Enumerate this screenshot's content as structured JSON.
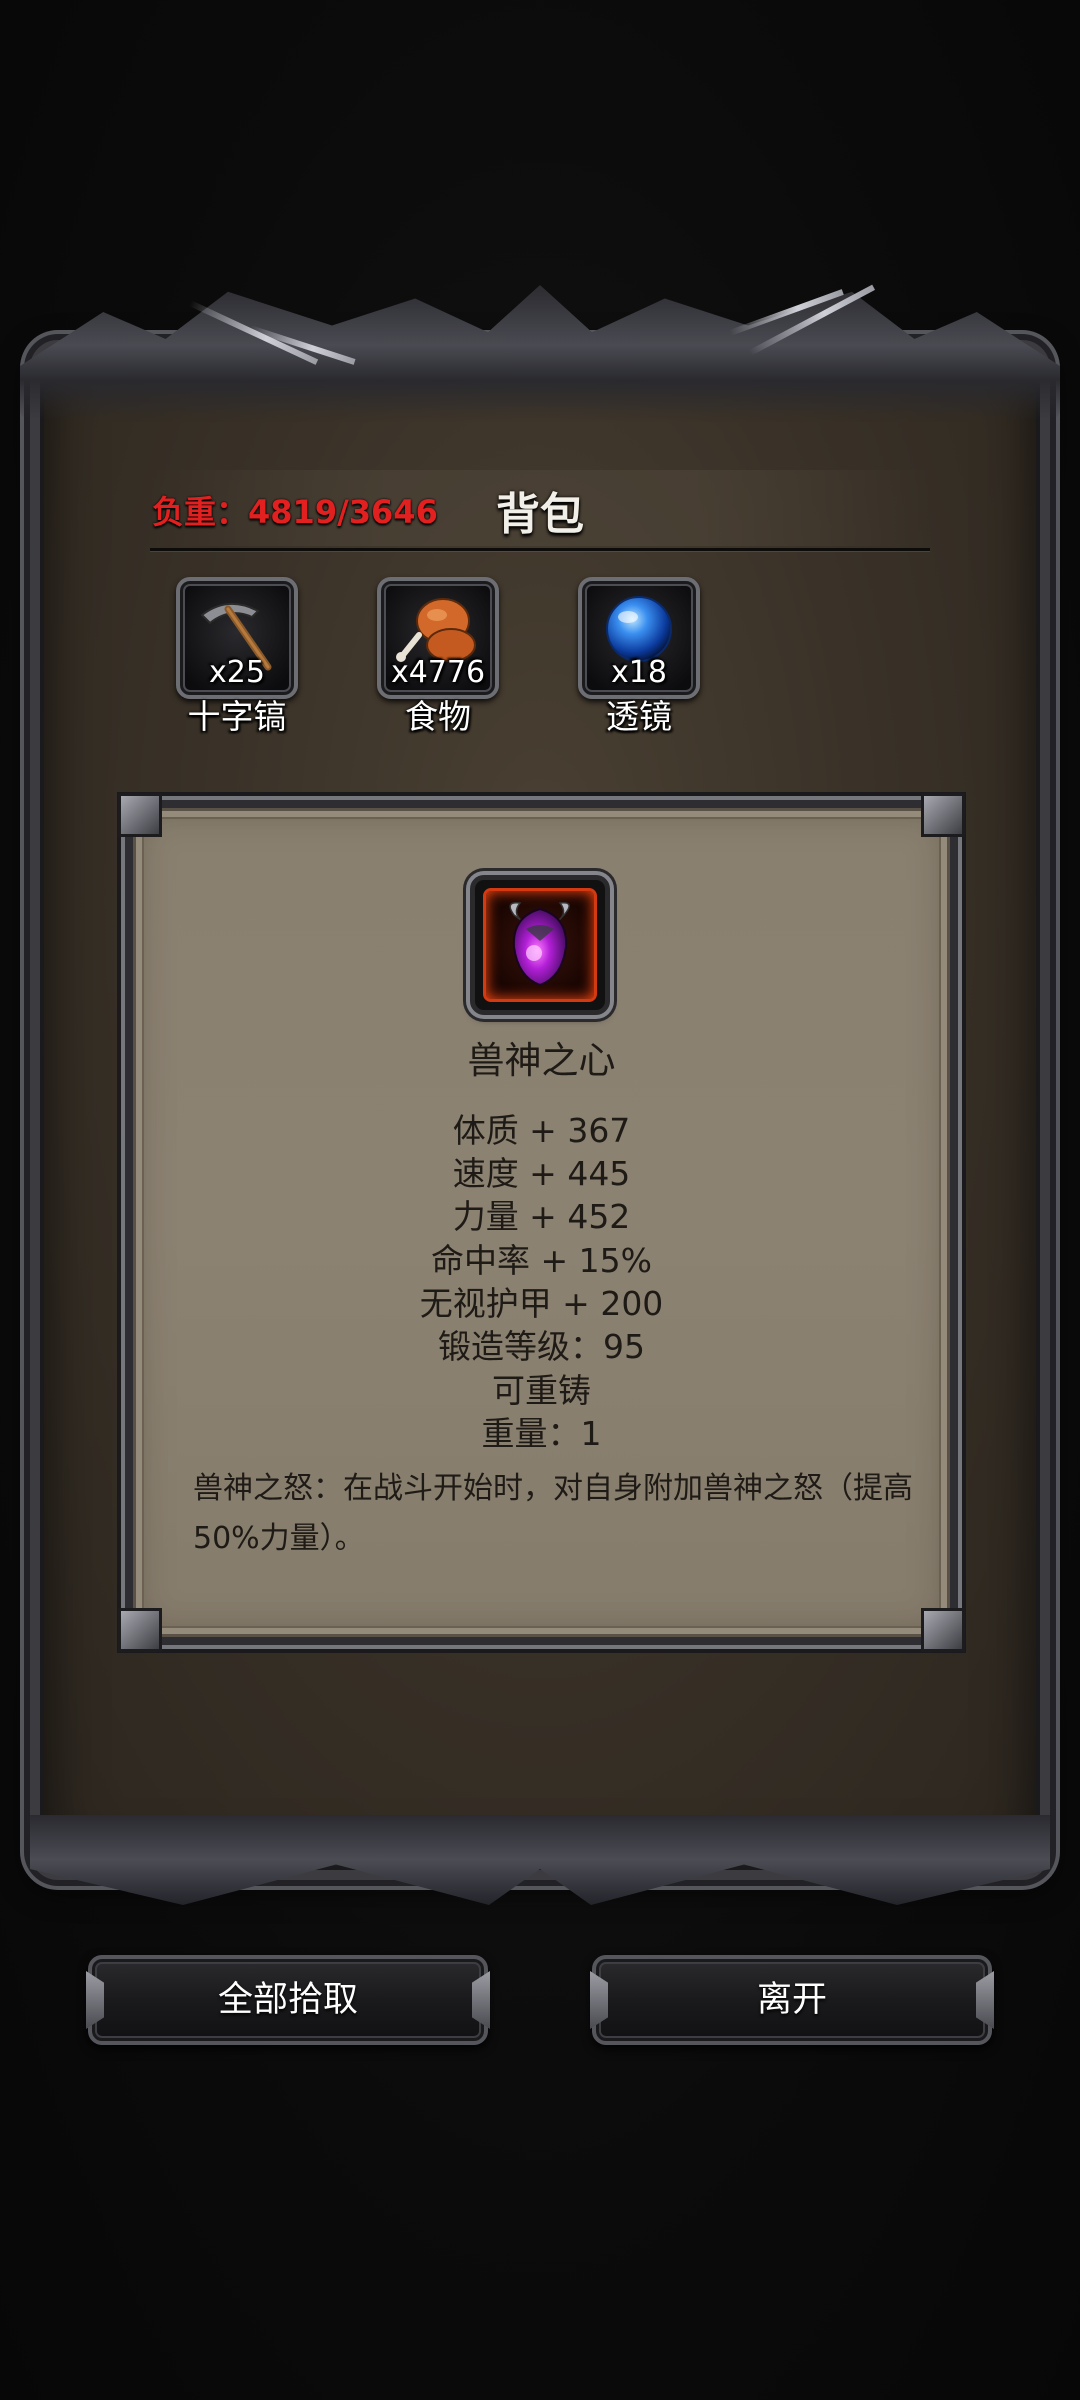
{
  "header": {
    "weight_label": "负重：",
    "weight_value": "4819/3646",
    "title": "背包"
  },
  "inventory": [
    {
      "icon": "pickaxe-icon",
      "count": "x25",
      "label": "十字镐"
    },
    {
      "icon": "food-meat-icon",
      "count": "x4776",
      "label": "食物"
    },
    {
      "icon": "lens-orb-icon",
      "count": "x18",
      "label": "透镜"
    }
  ],
  "item": {
    "icon": "beast-heart-gem-icon",
    "name": "兽神之心",
    "stats": [
      "体质 + 367",
      "速度 + 445",
      "力量 + 452",
      "命中率 + 15%",
      "无视护甲 + 200",
      "锻造等级：95",
      "可重铸",
      "重量：1"
    ],
    "description": "兽神之怒：在战斗开始时，对自身附加兽神之怒（提高50%力量）。"
  },
  "buttons": {
    "pickup_all": "全部拾取",
    "leave": "离开"
  },
  "colors": {
    "weight_red": "#e22020",
    "item_border_orange": "#d43a12",
    "panel_brown": "#3a3228",
    "parchment": "#8a8070"
  }
}
